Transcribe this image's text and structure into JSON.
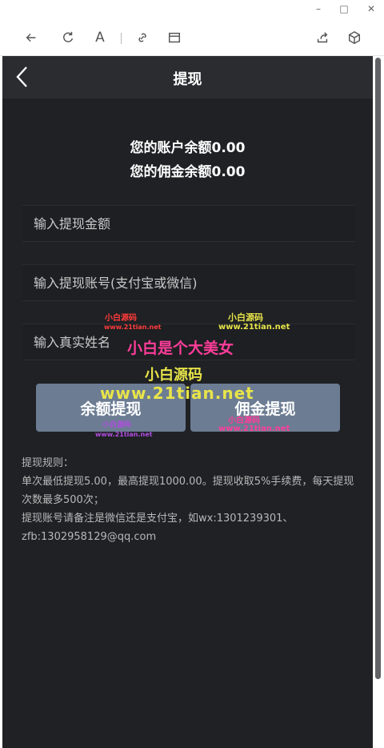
{
  "window": {
    "minimize_glyph": "–",
    "maximize_glyph": "□",
    "close_glyph": "✕"
  },
  "toolbar": {
    "icons": [
      "back-arrow-icon",
      "refresh-icon",
      "reader-font-icon",
      "link-icon",
      "window-icon",
      "share-icon",
      "cube-icon"
    ],
    "font_glyph": "A"
  },
  "nav": {
    "title": "提现",
    "back_icon": "chevron-left-icon"
  },
  "balance": {
    "account": "您的账户余额0.00",
    "commission": "您的佣金余额0.00"
  },
  "form": {
    "amount_placeholder": "输入提现金额",
    "account_placeholder": "输入提现账号(支付宝或微信)",
    "name_placeholder": "输入真实姓名"
  },
  "buttons": {
    "balance_withdraw": "余额提现",
    "commission_withdraw": "佣金提现"
  },
  "rules": {
    "heading": "提现规则：",
    "line1": "单次最低提现5.00，最高提现1000.00。提现收取5%手续费，每天提现次数最多500次；",
    "line2": "提现账号请备注是微信还是支付宝，如wx:1301239301、zfb:1302958129@qq.com"
  },
  "watermarks": {
    "small_cn_1": "小白源码",
    "small_url_1": "www.21tian.net",
    "yellow_cn": "小白源码",
    "yellow_url": "www.21tian.net",
    "pink_slogan": "小白是个大美女",
    "big_cn": "小白源码",
    "big_url": "www.21tian.net",
    "btn_cn_1": "小白源码",
    "btn_url_1": "www.21tian.net",
    "btn_cn_2": "小白源码",
    "btn_url_2": "www.21tian.net"
  },
  "colors": {
    "app_bg": "#1f2124",
    "nav_bg": "#2a2c30",
    "button_bg": "#6c7c93",
    "wm_yellow": "#e8e44a",
    "wm_pink": "#ff3d9a",
    "wm_purple": "#b04de0",
    "wm_red": "#ff3b3b"
  }
}
